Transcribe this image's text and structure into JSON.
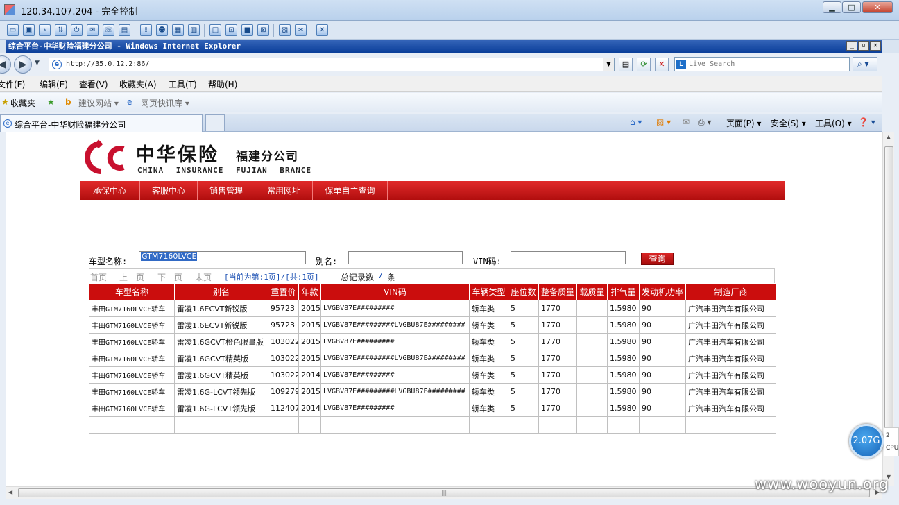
{
  "remote": {
    "title": "120.34.107.204 - 完全控制",
    "minimize": "▁",
    "restore": "□",
    "close": "✕"
  },
  "ie": {
    "window_title": "综合平台-中华财险福建分公司 - Windows Internet Explorer",
    "address": "http://35.0.12.2:86/",
    "search_placeholder": "Live Search",
    "menu": [
      "文件(F)",
      "编辑(E)",
      "查看(V)",
      "收藏夹(A)",
      "工具(T)",
      "帮助(H)"
    ],
    "favorites_label": "收藏夹",
    "fav_links": [
      "建议网站 ▾",
      "网页快讯库 ▾"
    ],
    "tab_title": "综合平台-中华财险福建分公司",
    "commands": [
      "页面(P) ▾",
      "安全(S) ▾",
      "工具(O) ▾"
    ]
  },
  "site": {
    "logo_cn": "中华保险",
    "logo_branch": "福建分公司",
    "logo_en": "CHINA INSURANCE FUJIAN BRANCE",
    "brand_color": "#c8102e",
    "nav": [
      "承保中心",
      "客服中心",
      "销售管理",
      "常用网址",
      "保单自主查询"
    ]
  },
  "form": {
    "model_label": "车型名称:",
    "model_value": "GTM7160LVCE",
    "alias_label": "别名:",
    "alias_value": "",
    "vin_label": "VIN码:",
    "vin_value": "",
    "query_button": "查询"
  },
  "pager": {
    "first": "首页",
    "prev": "上一页",
    "next": "下一页",
    "last": "末页",
    "current": "[当前为第:1页]/[共:1页]",
    "total_label": "总记录数",
    "total_count": "7",
    "total_unit": "条"
  },
  "table": {
    "columns": [
      "车型名称",
      "别名",
      "重置价",
      "年款",
      "VIN码",
      "车辆类型",
      "座位数",
      "整备质量",
      "载质量",
      "排气量",
      "发动机功率",
      "制造厂商"
    ],
    "rows": [
      [
        "丰田GTM7160LVCE轿车",
        "雷凌1.6ECVT新锐版",
        "95723",
        "2015",
        "LVGBV87E#########",
        "轿车类",
        "5",
        "1770",
        "",
        "1.5980",
        "90",
        "广汽丰田汽车有限公司"
      ],
      [
        "丰田GTM7160LVCE轿车",
        "雷凌1.6ECVT新锐版",
        "95723",
        "2015",
        "LVGBV87E#########LVGBU87E#########",
        "轿车类",
        "5",
        "1770",
        "",
        "1.5980",
        "90",
        "广汽丰田汽车有限公司"
      ],
      [
        "丰田GTM7160LVCE轿车",
        "雷凌1.6GCVT橙色限量版",
        "103022",
        "2015",
        "LVGBV87E#########",
        "轿车类",
        "5",
        "1770",
        "",
        "1.5980",
        "90",
        "广汽丰田汽车有限公司"
      ],
      [
        "丰田GTM7160LVCE轿车",
        "雷凌1.6GCVT精英版",
        "103022",
        "2015",
        "LVGBV87E#########LVGBU87E#########",
        "轿车类",
        "5",
        "1770",
        "",
        "1.5980",
        "90",
        "广汽丰田汽车有限公司"
      ],
      [
        "丰田GTM7160LVCE轿车",
        "雷凌1.6GCVT精英版",
        "103022",
        "2014",
        "LVGBV87E#########",
        "轿车类",
        "5",
        "1770",
        "",
        "1.5980",
        "90",
        "广汽丰田汽车有限公司"
      ],
      [
        "丰田GTM7160LVCE轿车",
        "雷凌1.6G-LCVT领先版",
        "109279",
        "2015",
        "LVGBV87E#########LVGBU87E#########",
        "轿车类",
        "5",
        "1770",
        "",
        "1.5980",
        "90",
        "广汽丰田汽车有限公司"
      ],
      [
        "丰田GTM7160LVCE轿车",
        "雷凌1.6G-LCVT领先版",
        "112407",
        "2014",
        "LVGBV87E#########",
        "轿车类",
        "5",
        "1770",
        "",
        "1.5980",
        "90",
        "广汽丰田汽车有限公司"
      ],
      [
        "",
        "",
        "",
        "",
        "",
        "",
        "",
        "",
        "",
        "",
        "",
        ""
      ]
    ]
  },
  "overlay": {
    "perf_value": "2.07G",
    "perf_side_top": "2",
    "perf_side_bottom": "CPU",
    "watermark": "www.wooyun.org"
  }
}
